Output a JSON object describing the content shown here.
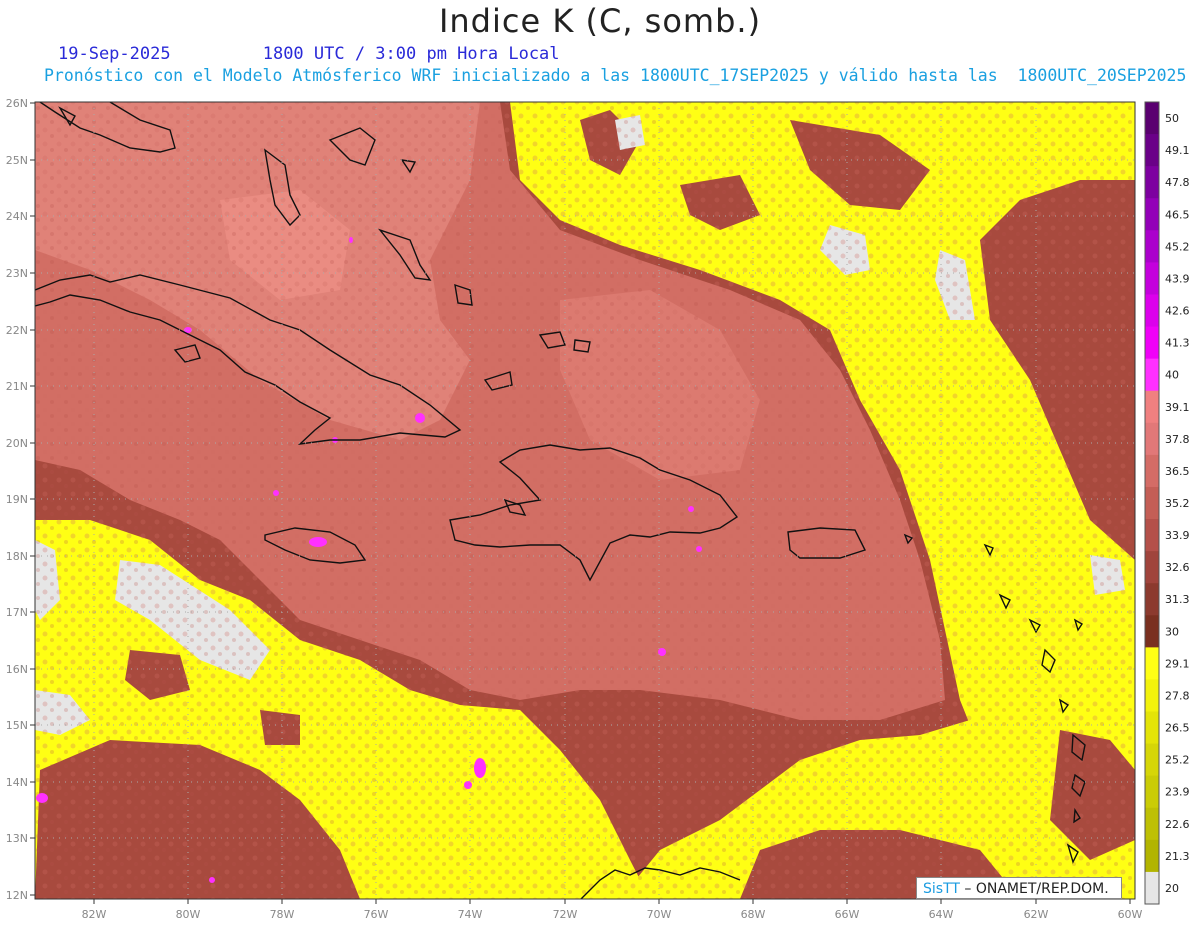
{
  "header": {
    "title": "Indice K (C, somb.)",
    "date": "19-Sep-2025",
    "time": "1800 UTC / 3:00 pm Hora Local",
    "forecast": "Pronóstico con el Modelo Atmósferico WRF inicializado a las 1800UTC_17SEP2025 y válido hasta las  1800UTC_20SEP2025"
  },
  "map": {
    "lat_labels": [
      "26N",
      "25N",
      "24N",
      "23N",
      "22N",
      "21N",
      "20N",
      "19N",
      "18N",
      "17N",
      "16N",
      "15N",
      "14N",
      "13N",
      "12N"
    ],
    "lon_labels": [
      "82W",
      "80W",
      "78W",
      "76W",
      "74W",
      "72W",
      "70W",
      "68W",
      "66W",
      "64W",
      "62W",
      "60W"
    ],
    "lat_range": [
      12,
      26
    ],
    "lon_range": [
      -83.2,
      -60
    ],
    "grid": true
  },
  "colorbar": {
    "levels": [
      "50",
      "49.1",
      "47.8",
      "46.5",
      "45.2",
      "43.9",
      "42.6",
      "41.3",
      "40",
      "39.1",
      "37.8",
      "36.5",
      "35.2",
      "33.9",
      "32.6",
      "31.3",
      "30",
      "29.1",
      "27.8",
      "26.5",
      "25.2",
      "23.9",
      "22.6",
      "21.3",
      "20"
    ],
    "colors": [
      "#5a0070",
      "#6a0088",
      "#7d00a0",
      "#9300b8",
      "#ab00cc",
      "#c400dd",
      "#dc00ec",
      "#f000f8",
      "#ff30ff",
      "#f08080",
      "#e27878",
      "#d46c66",
      "#c45e56",
      "#b4504a",
      "#a0443c",
      "#8c3a2e",
      "#7a3020",
      "#ffff14",
      "#f2f20c",
      "#e4e408",
      "#d6d608",
      "#cacc06",
      "#bec004",
      "#b2b400",
      "#e6e6e6"
    ]
  },
  "credit": {
    "sis": "SisTT",
    "org": " – ONAMET/REP.DOM."
  }
}
